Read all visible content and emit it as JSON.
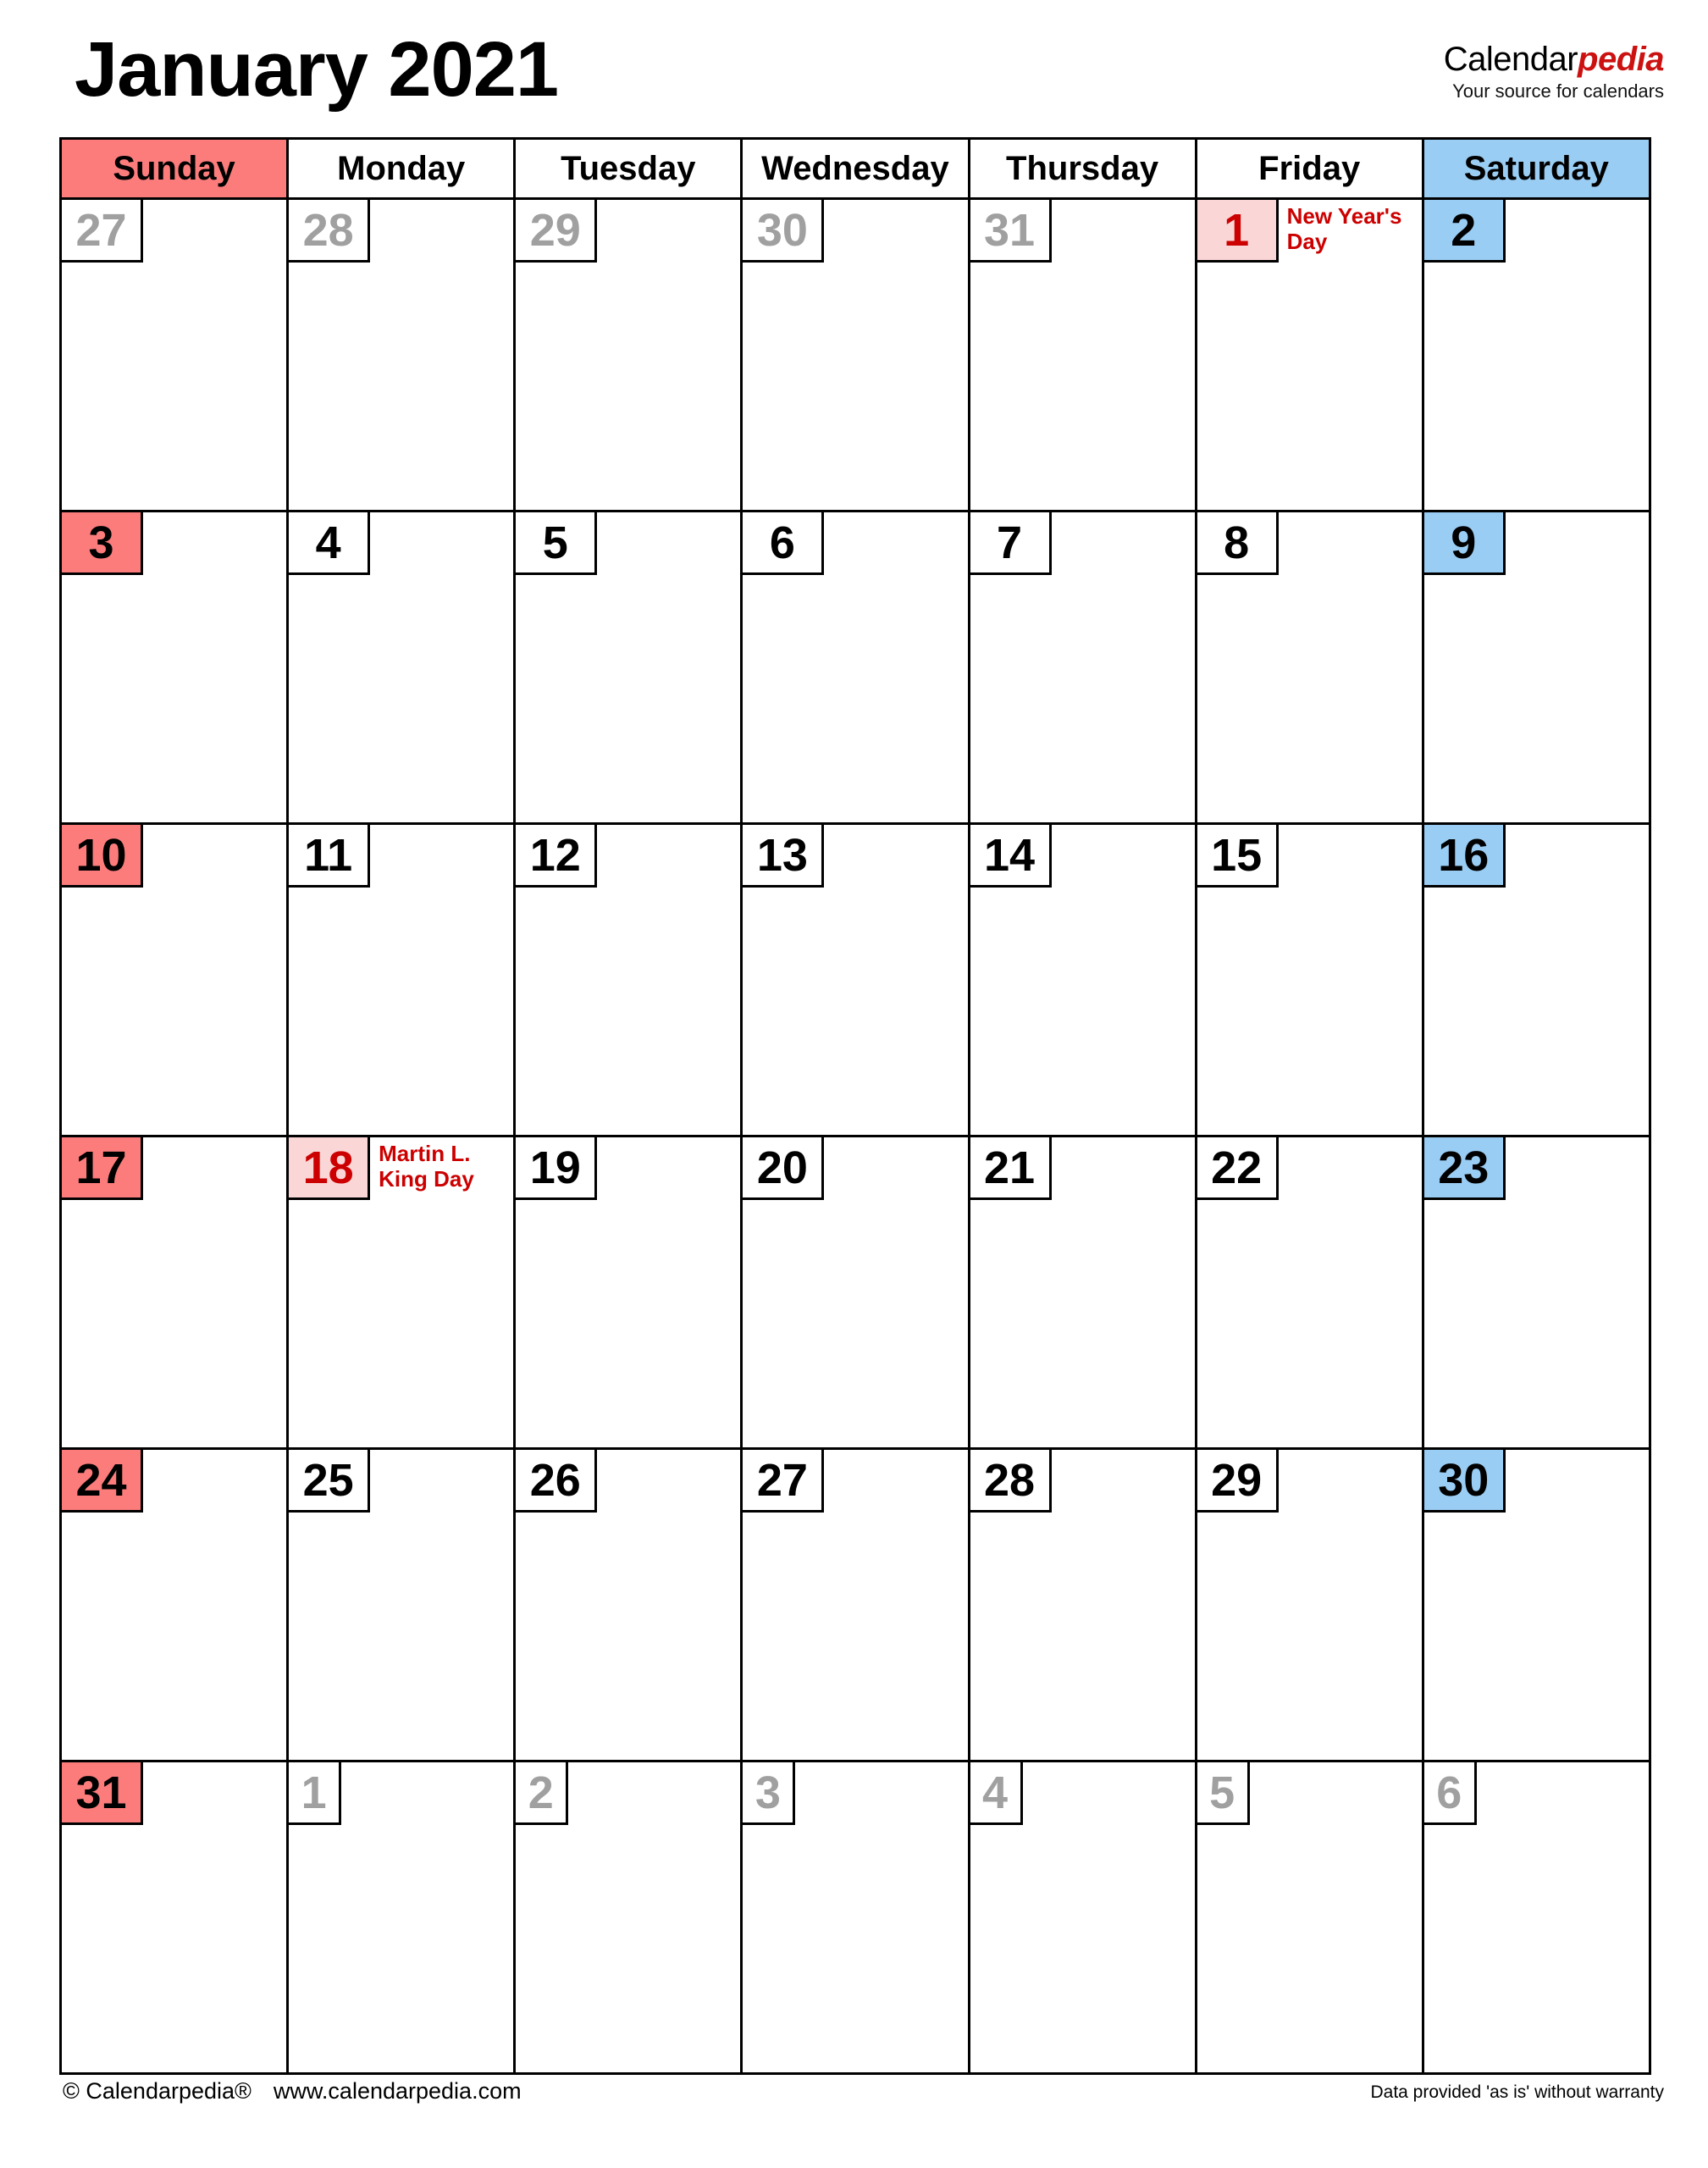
{
  "header": {
    "month_title": "January 2021",
    "brand_name_primary": "Calendar",
    "brand_name_accent": "pedia",
    "brand_tagline": "Your source for calendars",
    "accent_color": "#CC1111"
  },
  "colors": {
    "sunday_header_bg": "#FC7C7C",
    "saturday_header_bg": "#9ACDF4",
    "holiday_bg": "#FBD6D6",
    "holiday_text": "#CC0000",
    "other_month_text": "#A0A0A0",
    "grid_line": "#000000"
  },
  "weekday_headers": [
    {
      "label": "Sunday",
      "style": "sun"
    },
    {
      "label": "Monday",
      "style": "plain"
    },
    {
      "label": "Tuesday",
      "style": "plain"
    },
    {
      "label": "Wednesday",
      "style": "plain"
    },
    {
      "label": "Thursday",
      "style": "plain"
    },
    {
      "label": "Friday",
      "style": "plain"
    },
    {
      "label": "Saturday",
      "style": "sat"
    }
  ],
  "weeks": [
    [
      {
        "num": "27",
        "style": "other",
        "event": ""
      },
      {
        "num": "28",
        "style": "other",
        "event": ""
      },
      {
        "num": "29",
        "style": "other",
        "event": ""
      },
      {
        "num": "30",
        "style": "other",
        "event": ""
      },
      {
        "num": "31",
        "style": "other",
        "event": ""
      },
      {
        "num": "1",
        "style": "holiday",
        "event": "New Year's Day"
      },
      {
        "num": "2",
        "style": "sat",
        "event": ""
      }
    ],
    [
      {
        "num": "3",
        "style": "sun",
        "event": ""
      },
      {
        "num": "4",
        "style": "plain",
        "event": ""
      },
      {
        "num": "5",
        "style": "plain",
        "event": ""
      },
      {
        "num": "6",
        "style": "plain",
        "event": ""
      },
      {
        "num": "7",
        "style": "plain",
        "event": ""
      },
      {
        "num": "8",
        "style": "plain",
        "event": ""
      },
      {
        "num": "9",
        "style": "sat",
        "event": ""
      }
    ],
    [
      {
        "num": "10",
        "style": "sun",
        "event": ""
      },
      {
        "num": "11",
        "style": "plain",
        "event": ""
      },
      {
        "num": "12",
        "style": "plain",
        "event": ""
      },
      {
        "num": "13",
        "style": "plain",
        "event": ""
      },
      {
        "num": "14",
        "style": "plain",
        "event": ""
      },
      {
        "num": "15",
        "style": "plain",
        "event": ""
      },
      {
        "num": "16",
        "style": "sat",
        "event": ""
      }
    ],
    [
      {
        "num": "17",
        "style": "sun",
        "event": ""
      },
      {
        "num": "18",
        "style": "holiday",
        "event": "Martin L. King Day"
      },
      {
        "num": "19",
        "style": "plain",
        "event": ""
      },
      {
        "num": "20",
        "style": "plain",
        "event": ""
      },
      {
        "num": "21",
        "style": "plain",
        "event": ""
      },
      {
        "num": "22",
        "style": "plain",
        "event": ""
      },
      {
        "num": "23",
        "style": "sat",
        "event": ""
      }
    ],
    [
      {
        "num": "24",
        "style": "sun",
        "event": ""
      },
      {
        "num": "25",
        "style": "plain",
        "event": ""
      },
      {
        "num": "26",
        "style": "plain",
        "event": ""
      },
      {
        "num": "27",
        "style": "plain",
        "event": ""
      },
      {
        "num": "28",
        "style": "plain",
        "event": ""
      },
      {
        "num": "29",
        "style": "plain",
        "event": ""
      },
      {
        "num": "30",
        "style": "sat",
        "event": ""
      }
    ],
    [
      {
        "num": "31",
        "style": "sun",
        "event": ""
      },
      {
        "num": "1",
        "style": "other narrow",
        "event": ""
      },
      {
        "num": "2",
        "style": "other narrow",
        "event": ""
      },
      {
        "num": "3",
        "style": "other narrow",
        "event": ""
      },
      {
        "num": "4",
        "style": "other narrow",
        "event": ""
      },
      {
        "num": "5",
        "style": "other narrow",
        "event": ""
      },
      {
        "num": "6",
        "style": "other narrow",
        "event": ""
      }
    ]
  ],
  "footer": {
    "copyright": "© Calendarpedia®",
    "website": "www.calendarpedia.com",
    "disclaimer": "Data provided 'as is' without warranty"
  }
}
